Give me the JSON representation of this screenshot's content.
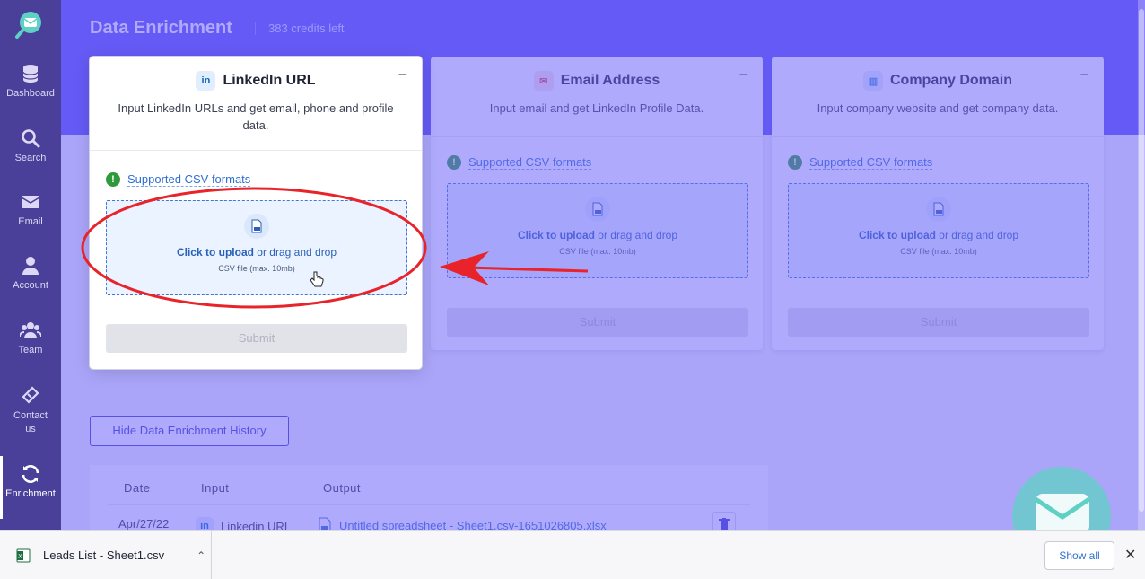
{
  "sidebar": {
    "items": [
      {
        "label": "Dashboard",
        "icon": "database-icon"
      },
      {
        "label": "Search",
        "icon": "search-icon"
      },
      {
        "label": "Email",
        "icon": "envelope-icon"
      },
      {
        "label": "Account",
        "icon": "user-icon"
      },
      {
        "label": "Team",
        "icon": "team-icon"
      },
      {
        "label": "Contact us",
        "icon": "ticket-icon"
      },
      {
        "label": "Enrichment",
        "icon": "refresh-icon"
      }
    ]
  },
  "header": {
    "title": "Data Enrichment",
    "credits": "383 credits left"
  },
  "cards": [
    {
      "title": "LinkedIn URL",
      "icon": "linkedin-icon",
      "icon_text": "in",
      "description": "Input LinkedIn URLs and get email, phone and profile data.",
      "csv_link": "Supported CSV formats",
      "upload_bold": "Click to upload",
      "upload_rest": " or drag and drop",
      "upload_sub": "CSV file (max. 10mb)",
      "submit": "Submit",
      "collapse": "−"
    },
    {
      "title": "Email Address",
      "icon": "mail-icon",
      "description": "Input email and get LinkedIn Profile Data.",
      "csv_link": "Supported CSV formats",
      "upload_bold": "Click to upload",
      "upload_rest": " or drag and drop",
      "upload_sub": "CSV file (max. 10mb)",
      "submit": "Submit",
      "collapse": "−"
    },
    {
      "title": "Company Domain",
      "icon": "building-icon",
      "description": "Input company website and get company data.",
      "csv_link": "Supported CSV formats",
      "upload_bold": "Click to upload",
      "upload_rest": " or drag and drop",
      "upload_sub": "CSV file (max. 10mb)",
      "submit": "Submit",
      "collapse": "−"
    }
  ],
  "history": {
    "toggle_label": "Hide Data Enrichment History",
    "columns": [
      "Date",
      "Input",
      "Output"
    ],
    "rows": [
      {
        "date": "Apr/27/22",
        "input": "Linkedin URL",
        "output": "Untitled spreadsheet - Sheet1.csv-1651026805.xlsx"
      }
    ]
  },
  "downloads": {
    "file_name": "Leads List - Sheet1.csv",
    "show_all": "Show all"
  },
  "colors": {
    "sidebar": "#4a3f99",
    "hero": "#5b4ff0",
    "accent": "#2f6fd0",
    "annotation": "#e8242a"
  }
}
